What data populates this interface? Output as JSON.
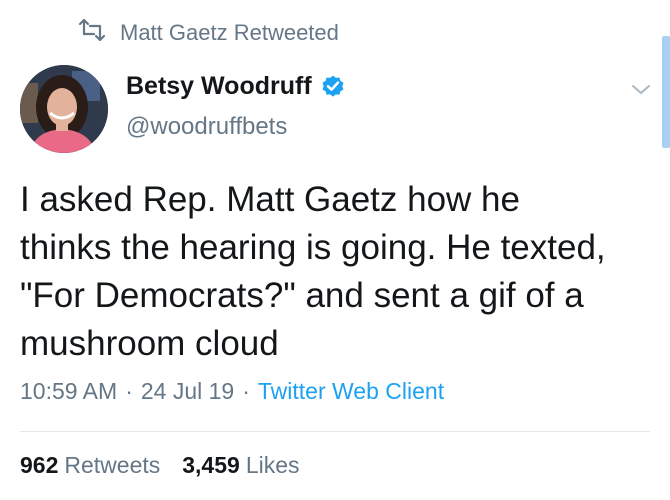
{
  "retweet_header": {
    "text": "Matt Gaetz Retweeted",
    "icon": "retweet-icon"
  },
  "author": {
    "display_name": "Betsy Woodruff",
    "handle": "@woodruffbets",
    "verified": true,
    "verified_color": "#1da1f2"
  },
  "tweet": {
    "text": "I asked Rep. Matt Gaetz how he\nthinks the hearing is going. He texted,\n\"For Democrats?\" and sent a gif of a\nmushroom cloud"
  },
  "meta": {
    "time": "10:59 AM",
    "separator": "·",
    "date": "24 Jul 19",
    "client": "Twitter Web Client"
  },
  "stats": {
    "retweets_count": "962",
    "retweets_label": "Retweets",
    "likes_count": "3,459",
    "likes_label": "Likes"
  },
  "colors": {
    "link": "#1da1f2",
    "secondary_text": "#657786",
    "primary_text": "#14171a"
  }
}
